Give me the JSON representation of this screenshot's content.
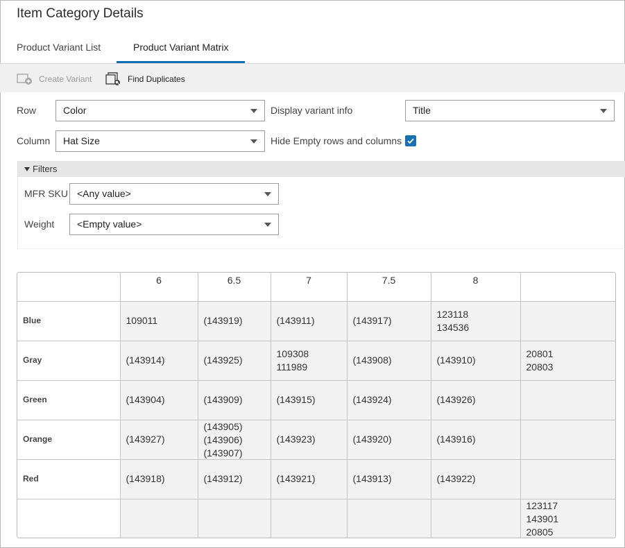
{
  "page": {
    "title": "Item Category Details"
  },
  "tabs": [
    {
      "label": "Product Variant List",
      "active": false
    },
    {
      "label": "Product Variant Matrix",
      "active": true
    }
  ],
  "toolbar": {
    "create_variant": "Create Variant",
    "find_duplicates": "Find Duplicates"
  },
  "settings": {
    "row_label": "Row",
    "row_value": "Color",
    "column_label": "Column",
    "column_value": "Hat Size",
    "display_label": "Display variant info",
    "display_value": "Title",
    "hide_empty_label": "Hide Empty rows and columns",
    "hide_empty_checked": true
  },
  "filters": {
    "header": "Filters",
    "mfr_sku_label": "MFR SKU",
    "mfr_sku_value": "<Any value>",
    "weight_label": "Weight",
    "weight_value": "<Empty value>"
  },
  "matrix": {
    "columns": [
      "",
      "6",
      "6.5",
      "7",
      "7.5",
      "8",
      ""
    ],
    "rows": [
      {
        "label": "Blue",
        "cells": [
          [
            "109011"
          ],
          [
            "(143919)"
          ],
          [
            "(143911)"
          ],
          [
            "(143917)"
          ],
          [
            "123118",
            "134536"
          ],
          []
        ]
      },
      {
        "label": "Gray",
        "cells": [
          [
            "(143914)"
          ],
          [
            "(143925)"
          ],
          [
            "109308",
            "111989"
          ],
          [
            "(143908)"
          ],
          [
            "(143910)"
          ],
          [
            "20801",
            "20803"
          ]
        ]
      },
      {
        "label": "Green",
        "cells": [
          [
            "(143904)"
          ],
          [
            "(143909)"
          ],
          [
            "(143915)"
          ],
          [
            "(143924)"
          ],
          [
            "(143926)"
          ],
          []
        ]
      },
      {
        "label": "Orange",
        "cells": [
          [
            "(143927)"
          ],
          [
            "(143905)",
            "(143906)",
            "(143907)"
          ],
          [
            "(143923)"
          ],
          [
            "(143920)"
          ],
          [
            "(143916)"
          ],
          []
        ]
      },
      {
        "label": "Red",
        "cells": [
          [
            "(143918)"
          ],
          [
            "(143912)"
          ],
          [
            "(143921)"
          ],
          [
            "(143913)"
          ],
          [
            "(143922)"
          ],
          []
        ]
      },
      {
        "label": "",
        "cells": [
          [],
          [],
          [],
          [],
          [],
          [
            "123117",
            "143901",
            "20805"
          ]
        ]
      }
    ]
  },
  "colors": {
    "accent": "#0a6fb3",
    "toolbar_bg": "#f0f0f0",
    "cell_bg": "#f2f2f2"
  }
}
